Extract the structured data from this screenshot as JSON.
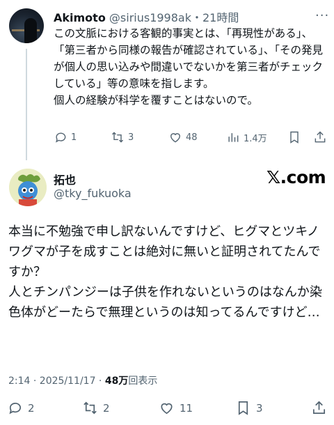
{
  "reply": {
    "display_name": "Akimoto",
    "handle": "@sirius1998ak",
    "time": "・21時間",
    "more": "···",
    "text": [
      "この文脈における客観的事実とは、「再現性がある」、「第三者から同様の報告が確認されている」、「その発見が個人の思い込みや間違いでないかを第三者がチェックしている」等の意味を指します。",
      "個人の経験が科学を覆すことはないので。"
    ],
    "actions": {
      "replies": "1",
      "reposts": "3",
      "likes": "48",
      "views": "1.4万"
    }
  },
  "post": {
    "display_name": "拓也",
    "handle": "@tky_fukuoka",
    "logo": "𝕏.com",
    "text": [
      "本当に不勉強で申し訳ないんですけど、ヒグマとツキノワグマが子を成すことは絶対に無いと証明されてたんですか？",
      "人とチンパンジーは子供を作れないというのはなんか染色体がどーたらで無理というのは知ってるんですけど…"
    ],
    "timestamp": "2:14 · 2025/11/17 · ",
    "views_count": "48万",
    "views_label": "回表示",
    "actions": {
      "replies": "2",
      "reposts": "2",
      "likes": "11",
      "bookmarks": "3"
    }
  },
  "icons": [
    "comment-icon",
    "repost-icon",
    "heart-icon",
    "views-icon",
    "bookmark-icon",
    "share-icon",
    "more-icon"
  ],
  "colors": {
    "text": "#0f1419",
    "secondary": "#536471",
    "divider": "#cfd9de"
  }
}
